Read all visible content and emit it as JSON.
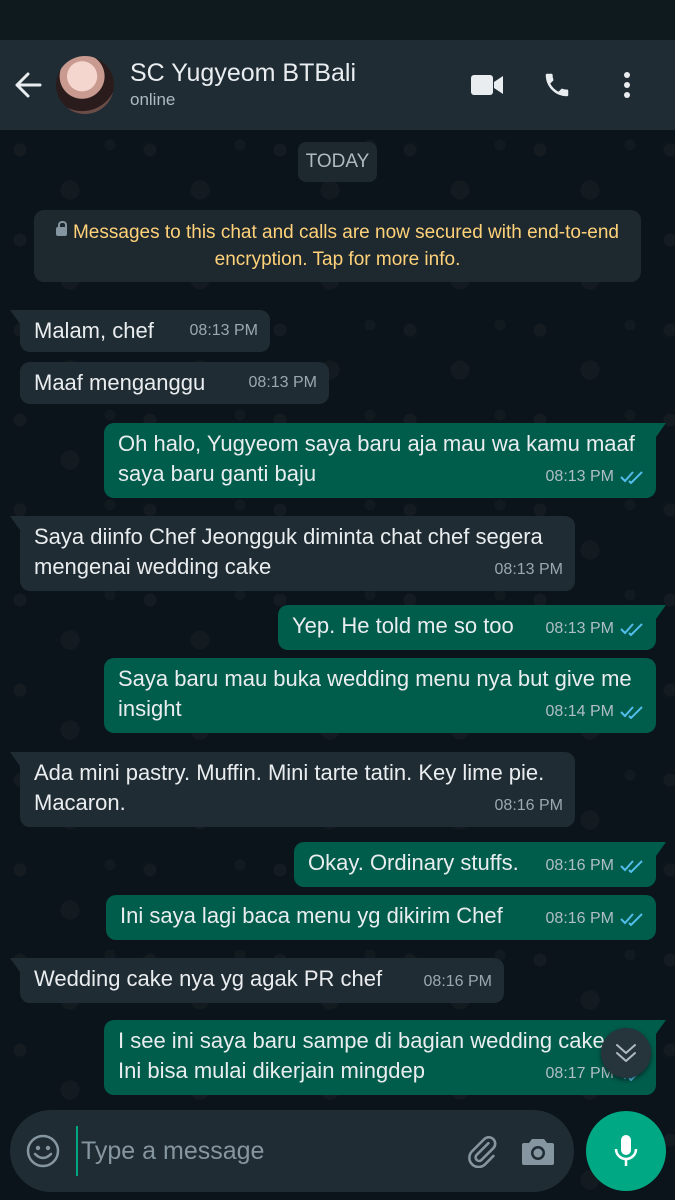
{
  "header": {
    "contact_name": "SC Yugyeom BTBali",
    "status": "online",
    "icons": {
      "back": "arrow-left-icon",
      "video": "video-call-icon",
      "call": "phone-icon",
      "menu": "more-vert-icon"
    }
  },
  "chat": {
    "date_chip": "TODAY",
    "encryption_notice": "Messages to this chat and calls are now secured with end-to-end encryption. Tap for more info.",
    "messages": [
      {
        "dir": "in",
        "text": "Malam, chef",
        "time": "08:13 PM"
      },
      {
        "dir": "in",
        "text": "Maaf menganggu",
        "time": "08:13 PM"
      },
      {
        "dir": "out",
        "text": "Oh halo, Yugyeom saya baru aja mau wa kamu maaf saya baru ganti baju",
        "time": "08:13 PM",
        "status": "read"
      },
      {
        "dir": "in",
        "text": "Saya diinfo Chef Jeongguk diminta chat chef segera mengenai wedding cake",
        "time": "08:13 PM"
      },
      {
        "dir": "out",
        "text": "Yep. He told me so too",
        "time": "08:13 PM",
        "status": "read"
      },
      {
        "dir": "out",
        "text": "Saya baru mau buka wedding menu nya but give me insight",
        "time": "08:14 PM",
        "status": "read"
      },
      {
        "dir": "in",
        "text": "Ada mini pastry. Muffin. Mini tarte tatin. Key lime pie. Macaron.",
        "time": "08:16 PM"
      },
      {
        "dir": "out",
        "text": "Okay. Ordinary stuffs.",
        "time": "08:16 PM",
        "status": "read"
      },
      {
        "dir": "out",
        "text": "Ini saya lagi baca menu yg dikirim Chef",
        "time": "08:16 PM",
        "status": "read"
      },
      {
        "dir": "in",
        "text": "Wedding cake nya yg agak PR chef",
        "time": "08:16 PM"
      },
      {
        "dir": "out",
        "text": "I see ini saya baru sampe di bagian wedding cake. Ini bisa mulai dikerjain mingdep",
        "time": "08:17 PM",
        "status": "read"
      }
    ]
  },
  "composer": {
    "placeholder": "Type a message",
    "icons": {
      "emoji": "emoji-icon",
      "attach": "paperclip-icon",
      "camera": "camera-icon",
      "mic": "microphone-icon",
      "scroll": "chevrons-down-icon"
    }
  },
  "colors": {
    "header_bg": "#1f2c34",
    "chat_bg": "#0b141a",
    "incoming_bubble": "#202c33",
    "outgoing_bubble": "#005c4b",
    "accent": "#00a884",
    "read_ticks": "#53bdeb",
    "encryption_text": "#ffd279"
  }
}
